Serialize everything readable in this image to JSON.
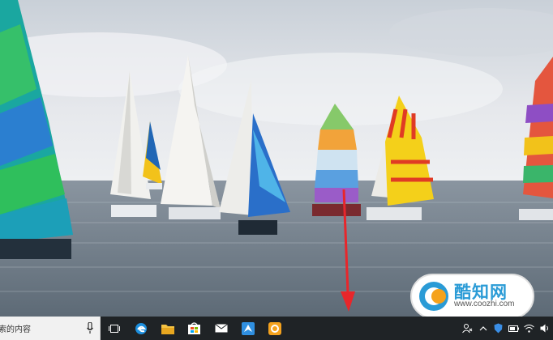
{
  "desktop": {
    "wallpaper": "sailboats-regatta-photo",
    "sky_color": "#dfe3e8",
    "sea_color": "#6f7b86",
    "annotation_arrow_color": "#e8262b"
  },
  "taskbar": {
    "search_text": "索的内容",
    "pinned": [
      {
        "name": "task-view-icon"
      },
      {
        "name": "edge-icon"
      },
      {
        "name": "file-explorer-icon"
      },
      {
        "name": "store-icon"
      },
      {
        "name": "mail-icon"
      },
      {
        "name": "qq-browser-icon"
      },
      {
        "name": "app-orange-icon"
      }
    ],
    "tray": [
      "people-icon",
      "chevron-up-icon",
      "shield-icon",
      "battery-icon",
      "wifi-icon",
      "volume-icon"
    ]
  },
  "watermark": {
    "text": "酷知网",
    "url": "www.coozhi.com",
    "color": "#2a9bd6"
  }
}
